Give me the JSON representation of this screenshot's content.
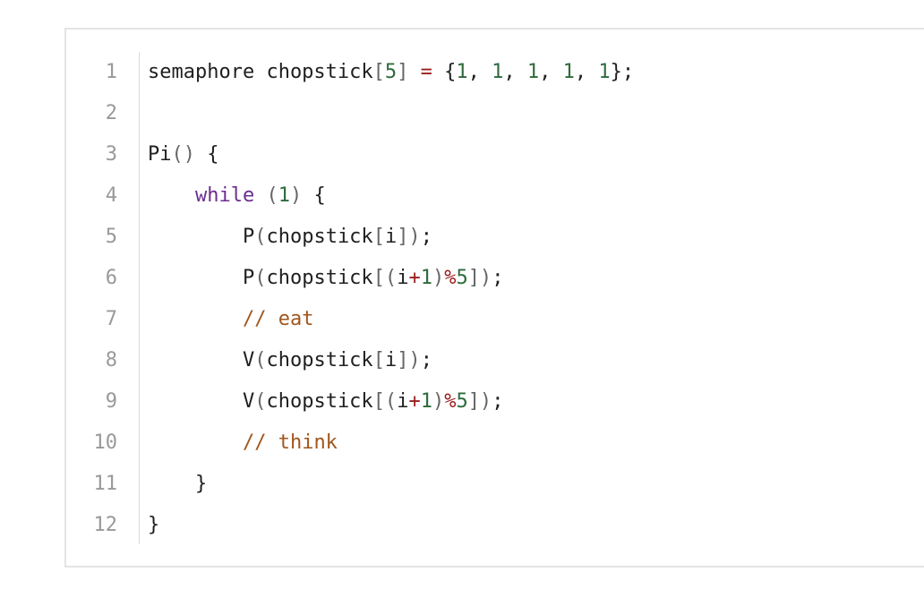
{
  "editor": {
    "lines": [
      {
        "number": "1",
        "tokens": [
          {
            "t": "semaphore chopstick",
            "c": "plain"
          },
          {
            "t": "[",
            "c": "bracket"
          },
          {
            "t": "5",
            "c": "num"
          },
          {
            "t": "]",
            "c": "bracket"
          },
          {
            "t": " ",
            "c": "plain"
          },
          {
            "t": "=",
            "c": "op"
          },
          {
            "t": " {",
            "c": "plain"
          },
          {
            "t": "1",
            "c": "num"
          },
          {
            "t": ", ",
            "c": "plain"
          },
          {
            "t": "1",
            "c": "num"
          },
          {
            "t": ", ",
            "c": "plain"
          },
          {
            "t": "1",
            "c": "num"
          },
          {
            "t": ", ",
            "c": "plain"
          },
          {
            "t": "1",
            "c": "num"
          },
          {
            "t": ", ",
            "c": "plain"
          },
          {
            "t": "1",
            "c": "num"
          },
          {
            "t": "};",
            "c": "plain"
          }
        ]
      },
      {
        "number": "2",
        "tokens": []
      },
      {
        "number": "3",
        "tokens": [
          {
            "t": "Pi",
            "c": "plain"
          },
          {
            "t": "()",
            "c": "bracket"
          },
          {
            "t": " {",
            "c": "plain"
          }
        ]
      },
      {
        "number": "4",
        "tokens": [
          {
            "t": "    ",
            "c": "plain"
          },
          {
            "t": "while",
            "c": "kw"
          },
          {
            "t": " ",
            "c": "plain"
          },
          {
            "t": "(",
            "c": "bracket"
          },
          {
            "t": "1",
            "c": "num"
          },
          {
            "t": ")",
            "c": "bracket"
          },
          {
            "t": " {",
            "c": "plain"
          }
        ]
      },
      {
        "number": "5",
        "tokens": [
          {
            "t": "        P",
            "c": "plain"
          },
          {
            "t": "(",
            "c": "bracket"
          },
          {
            "t": "chopstick",
            "c": "plain"
          },
          {
            "t": "[",
            "c": "bracket"
          },
          {
            "t": "i",
            "c": "plain"
          },
          {
            "t": "])",
            "c": "bracket"
          },
          {
            "t": ";",
            "c": "plain"
          }
        ]
      },
      {
        "number": "6",
        "tokens": [
          {
            "t": "        P",
            "c": "plain"
          },
          {
            "t": "(",
            "c": "bracket"
          },
          {
            "t": "chopstick",
            "c": "plain"
          },
          {
            "t": "[(",
            "c": "bracket"
          },
          {
            "t": "i",
            "c": "plain"
          },
          {
            "t": "+",
            "c": "op"
          },
          {
            "t": "1",
            "c": "num"
          },
          {
            "t": ")",
            "c": "bracket"
          },
          {
            "t": "%",
            "c": "op"
          },
          {
            "t": "5",
            "c": "num"
          },
          {
            "t": "])",
            "c": "bracket"
          },
          {
            "t": ";",
            "c": "plain"
          }
        ]
      },
      {
        "number": "7",
        "tokens": [
          {
            "t": "        ",
            "c": "plain"
          },
          {
            "t": "// eat",
            "c": "comment"
          }
        ]
      },
      {
        "number": "8",
        "tokens": [
          {
            "t": "        V",
            "c": "plain"
          },
          {
            "t": "(",
            "c": "bracket"
          },
          {
            "t": "chopstick",
            "c": "plain"
          },
          {
            "t": "[",
            "c": "bracket"
          },
          {
            "t": "i",
            "c": "plain"
          },
          {
            "t": "])",
            "c": "bracket"
          },
          {
            "t": ";",
            "c": "plain"
          }
        ]
      },
      {
        "number": "9",
        "tokens": [
          {
            "t": "        V",
            "c": "plain"
          },
          {
            "t": "(",
            "c": "bracket"
          },
          {
            "t": "chopstick",
            "c": "plain"
          },
          {
            "t": "[(",
            "c": "bracket"
          },
          {
            "t": "i",
            "c": "plain"
          },
          {
            "t": "+",
            "c": "op"
          },
          {
            "t": "1",
            "c": "num"
          },
          {
            "t": ")",
            "c": "bracket"
          },
          {
            "t": "%",
            "c": "op"
          },
          {
            "t": "5",
            "c": "num"
          },
          {
            "t": "])",
            "c": "bracket"
          },
          {
            "t": ";",
            "c": "plain"
          }
        ]
      },
      {
        "number": "10",
        "tokens": [
          {
            "t": "        ",
            "c": "plain"
          },
          {
            "t": "// think",
            "c": "comment"
          }
        ]
      },
      {
        "number": "11",
        "tokens": [
          {
            "t": "    }",
            "c": "plain"
          }
        ]
      },
      {
        "number": "12",
        "tokens": [
          {
            "t": "}",
            "c": "plain"
          }
        ]
      }
    ]
  },
  "colors": {
    "text": "#1f1f1f",
    "line_number": "#999999",
    "bracket": "#666666",
    "operator": "#9b1c1c",
    "number": "#2e6b3b",
    "keyword": "#6b2d8f",
    "comment": "#a0561d",
    "border": "#e3e3e3"
  }
}
